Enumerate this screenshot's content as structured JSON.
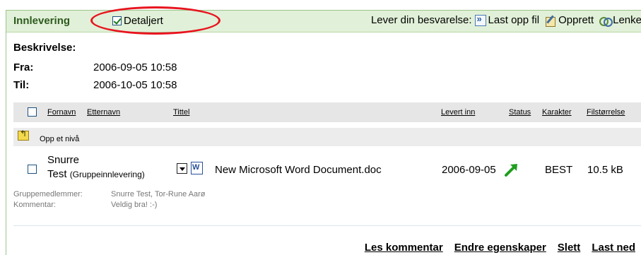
{
  "header": {
    "title": "Innlevering",
    "detailed_label": "Detaljert",
    "deliver_label": "Lever din besvarelse:",
    "actions": [
      {
        "label": "Last opp fil",
        "icon": "upload-icon"
      },
      {
        "label": "Opprett",
        "icon": "create-icon"
      },
      {
        "label": "Lenke",
        "icon": "link-icon"
      }
    ]
  },
  "meta": {
    "description_label": "Beskrivelse:",
    "from_label": "Fra:",
    "from_value": "2006-09-05 10:58",
    "to_label": "Til:",
    "to_value": "2006-10-05 10:58"
  },
  "table": {
    "columns": {
      "firstname": "Fornavn",
      "lastname": "Etternavn",
      "title": "Tittel",
      "delivered": "Levert inn",
      "status": "Status",
      "grade": "Karakter",
      "filesize": "Filstørrelse"
    },
    "up_level": "Opp et nivå",
    "row": {
      "firstname": "Snurre",
      "lastname": "Test",
      "group_note": "(Gruppeinnlevering)",
      "title": "New Microsoft Word Document.doc",
      "delivered": "2006-09-05",
      "grade": "BEST",
      "filesize": "10.5 kB",
      "status_icon": "green-arrow-up-right-icon"
    },
    "details": {
      "members_label": "Gruppemedlemmer:",
      "members_value": "Snurre Test, Tor-Rune Aarø",
      "comment_label": "Kommentar:",
      "comment_value": "Veldig bra! :-)"
    }
  },
  "bottom_actions": {
    "read_comment": "Les kommentar",
    "edit_properties": "Endre egenskaper",
    "delete": "Slett",
    "download": "Last ned"
  },
  "colors": {
    "header_bg": "#e1f0d8",
    "header_title": "#2d5b1f",
    "highlight_ellipse": "#e8141e",
    "status_arrow": "#1f9e1f"
  }
}
